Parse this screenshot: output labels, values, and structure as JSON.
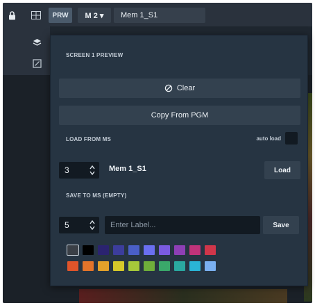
{
  "topbar": {
    "lock_icon": "lock-icon",
    "grid_icon": "grid-icon",
    "prw_label": "PRW",
    "mem_dropdown_label": "M 2 ▾",
    "mem_name": "Mem 1_S1"
  },
  "panel": {
    "title": "SCREEN 1 PREVIEW",
    "clear_label": "Clear",
    "copy_label": "Copy From PGM",
    "load_section_label": "LOAD FROM MS",
    "auto_load_label": "auto load",
    "load_number": "3",
    "load_memory_name": "Mem 1_S1",
    "load_button": "Load",
    "save_section_label": "SAVE TO MS (empty)",
    "save_number": "5",
    "label_placeholder": "Enter Label...",
    "save_button": "Save"
  },
  "colors": {
    "row1": [
      "#3a3f46",
      "#000000",
      "#2b2370",
      "#3c3d9c",
      "#4a5fc7",
      "#6a6ff0",
      "#7a5be0",
      "#8e3fb5",
      "#c0337a",
      "#d0364a"
    ],
    "row2": [
      "#e0542a",
      "#e3742a",
      "#e3a12a",
      "#d6c92a",
      "#a6c93a",
      "#6fae3a",
      "#3aa86a",
      "#2aa8a0",
      "#2ab4d6",
      "#7ab0f0"
    ],
    "selected_index": 0
  }
}
